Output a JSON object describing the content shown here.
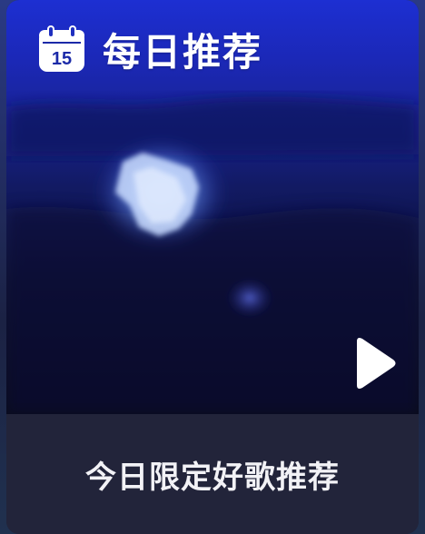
{
  "card": {
    "title": "每日推荐",
    "subtitle": "今日限定好歌推荐",
    "calendar_icon": {
      "name": "calendar-icon",
      "day": "15"
    },
    "play_icon": "play-icon"
  },
  "colors": {
    "cover_top": "#1d2fd2",
    "cover_bottom": "#06081b",
    "footer_bg": "#22243a",
    "text": "#ffffff"
  }
}
